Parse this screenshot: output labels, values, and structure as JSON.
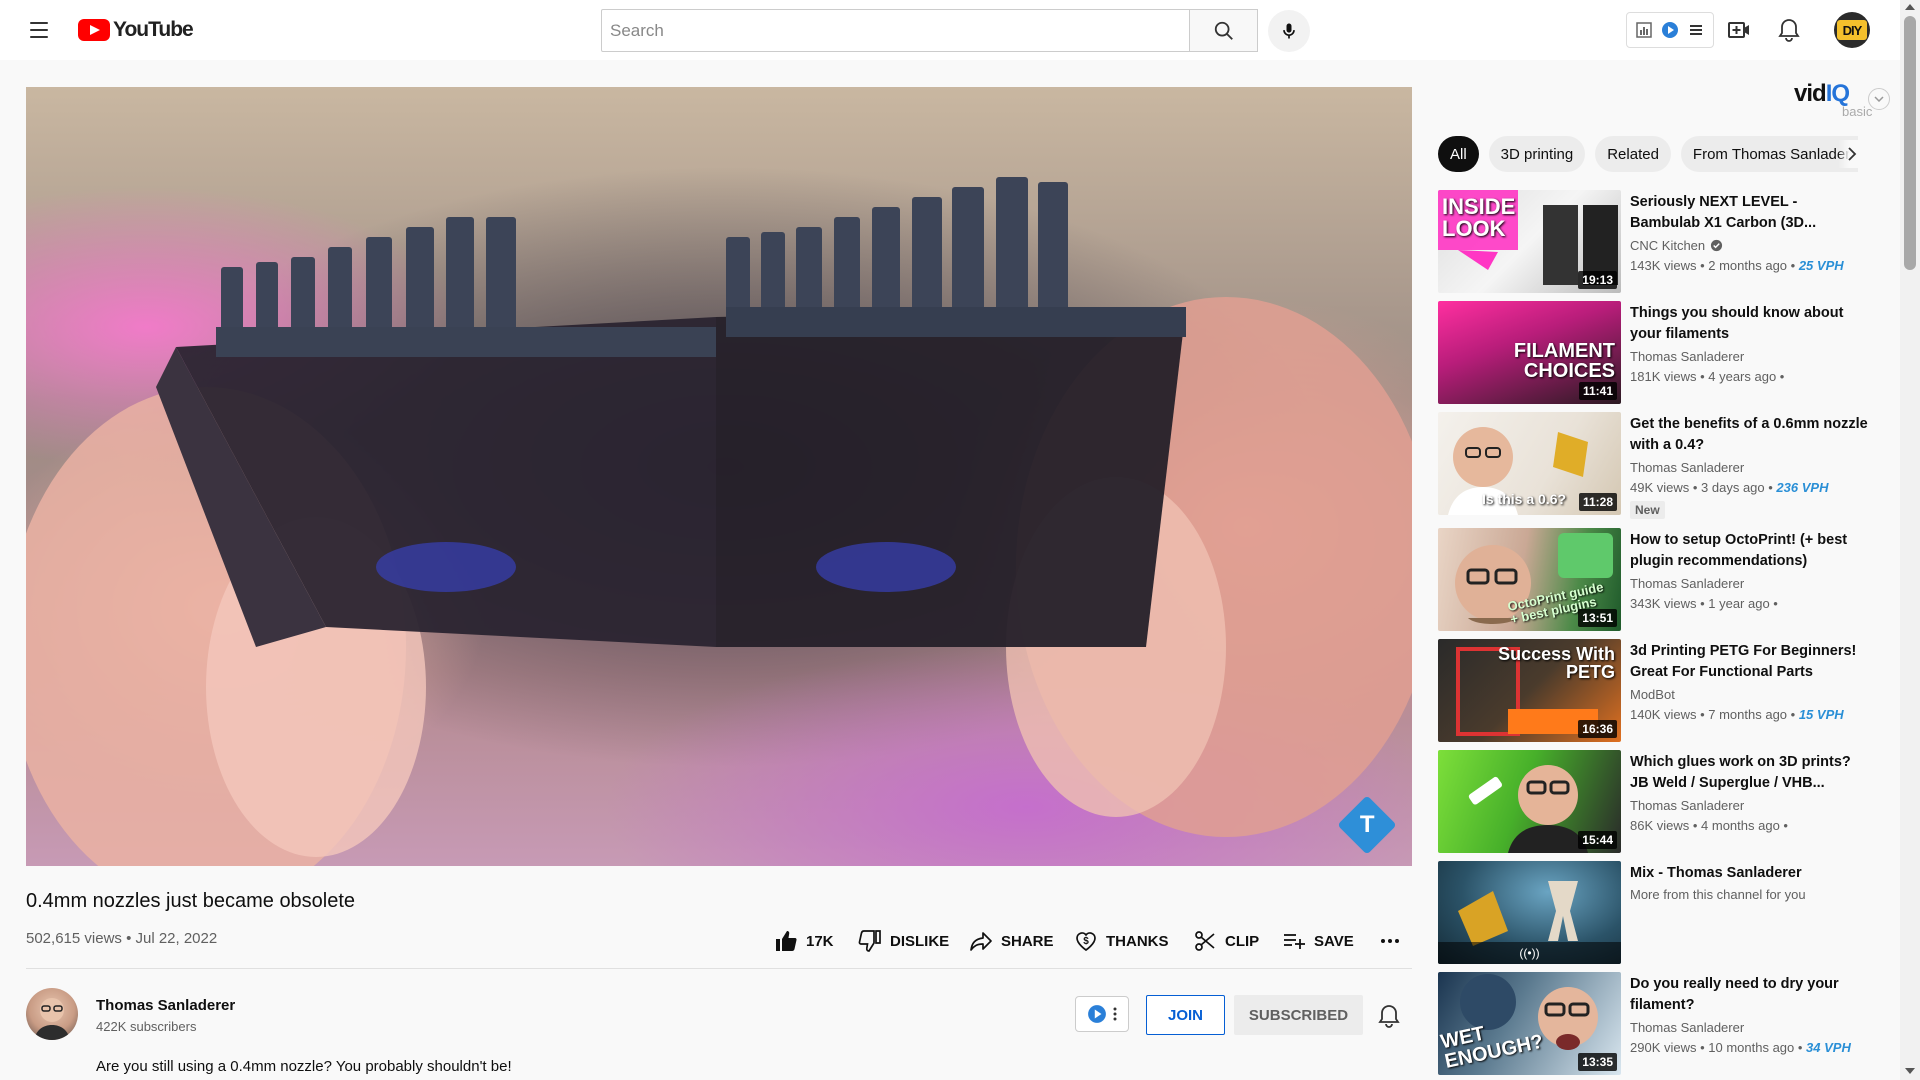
{
  "header": {
    "logo_text": "YouTube",
    "search_placeholder": "Search",
    "avatar_text": "DIY"
  },
  "player": {
    "overlay_letter": "T"
  },
  "video": {
    "title": "0.4mm nozzles just became obsolete",
    "meta": "502,615 views • Jul 22, 2022",
    "actions": {
      "like": "17K",
      "dislike": "DISLIKE",
      "share": "SHARE",
      "thanks": "THANKS",
      "clip": "CLIP",
      "save": "SAVE"
    }
  },
  "channel": {
    "name": "Thomas Sanladerer",
    "subscribers": "422K subscribers",
    "join_label": "JOIN",
    "subscribed_label": "SUBSCRIBED"
  },
  "description_first_line": "Are you still using a 0.4mm nozzle? You probably shouldn't be!",
  "vidiq": {
    "brand_main": "vid",
    "brand_accent": "IQ",
    "plan": "basic"
  },
  "chips": [
    "All",
    "3D printing",
    "Related",
    "From Thomas Sanladerer"
  ],
  "recommendations": [
    {
      "title": "Seriously NEXT LEVEL - Bambulab X1 Carbon (3D...",
      "channel": "CNC Kitchen",
      "verified": true,
      "stats": "143K views • 2 months ago •",
      "vph": "25 VPH",
      "duration": "19:13",
      "thumb_text": "INSIDE\nLOOK"
    },
    {
      "title": "Things you should know about your filaments",
      "channel": "Thomas Sanladerer",
      "stats": "181K views • 4 years ago •",
      "vph": "",
      "duration": "11:41",
      "thumb_text": "FILAMENT\nCHOICES"
    },
    {
      "title": "Get the benefits of a 0.6mm nozzle with a 0.4?",
      "channel": "Thomas Sanladerer",
      "stats": "49K views • 3 days ago •",
      "vph": "236 VPH",
      "duration": "11:28",
      "badge": "New",
      "thumb_text": "Is this a 0.6?"
    },
    {
      "title": "How to setup OctoPrint! (+ best plugin recommendations)",
      "channel": "Thomas Sanladerer",
      "stats": "343K views • 1 year ago •",
      "vph": "",
      "duration": "13:51",
      "thumb_text": "OctoPrint guide\n+ best plugins"
    },
    {
      "title": "3d Printing PETG For Beginners! Great For Functional Parts",
      "channel": "ModBot",
      "stats": "140K views • 7 months ago •",
      "vph": "15 VPH",
      "duration": "16:36",
      "thumb_text": "Success With\nPETG"
    },
    {
      "title": "Which glues work on 3D prints? JB Weld / Superglue / VHB...",
      "channel": "Thomas Sanladerer",
      "stats": "86K views • 4 months ago •",
      "vph": "",
      "duration": "15:44",
      "thumb_text": ""
    },
    {
      "title": "Mix - Thomas Sanladerer",
      "channel": "More from this channel for you",
      "stats": "",
      "vph": "",
      "duration": "",
      "live_icon": "((•))",
      "thumb_text": ""
    },
    {
      "title": "Do you really need to dry your filament?",
      "channel": "Thomas Sanladerer",
      "stats": "290K views • 10 months ago •",
      "vph": "34 VPH",
      "duration": "13:35",
      "thumb_text": "WET\nENOUGH?"
    }
  ],
  "colors": {
    "brand_red": "#ff0000",
    "vph_blue": "#2a8fd6",
    "join_blue": "#065fd4"
  },
  "icons": [
    "menu-icon",
    "search-icon",
    "mic-icon",
    "create-icon",
    "bell-icon",
    "like-icon",
    "dislike-icon",
    "share-icon",
    "thanks-icon",
    "clip-icon",
    "save-icon",
    "more-icon",
    "verified-icon",
    "chevron-right-icon"
  ]
}
